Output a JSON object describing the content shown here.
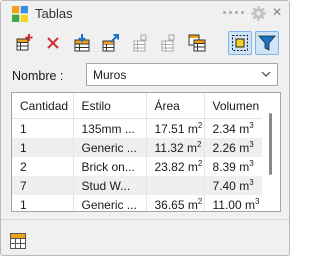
{
  "window": {
    "title": "Tablas"
  },
  "toolbar": {
    "buttons": [
      {
        "name": "add-schedule-button",
        "icon": "add-table-icon"
      },
      {
        "name": "delete-button",
        "icon": "delete-x-icon"
      },
      {
        "name": "import-button",
        "icon": "import-icon"
      },
      {
        "name": "export-button",
        "icon": "export-icon"
      },
      {
        "name": "settings-button",
        "icon": "table-settings-icon"
      },
      {
        "name": "settings-2-button",
        "icon": "table-settings-2-icon"
      },
      {
        "name": "copy-button",
        "icon": "copy-icon"
      },
      {
        "name": "select-button",
        "icon": "select-icon"
      },
      {
        "name": "filter-button",
        "icon": "filter-icon"
      }
    ]
  },
  "name_field": {
    "label": "Nombre :",
    "value": "Muros"
  },
  "table": {
    "headers": [
      "Cantidad",
      "Estilo",
      "Área",
      "Volumen"
    ],
    "rows": [
      {
        "cantidad": "1",
        "estilo": "135mm ...",
        "area": "17.51 m",
        "area_unit_exp": "2",
        "volumen": "2.34 m",
        "vol_unit_exp": "3"
      },
      {
        "cantidad": "1",
        "estilo": "Generic ...",
        "area": "11.32 m",
        "area_unit_exp": "2",
        "volumen": "2.26 m",
        "vol_unit_exp": "3"
      },
      {
        "cantidad": "2",
        "estilo": "Brick on...",
        "area": "23.82 m",
        "area_unit_exp": "2",
        "volumen": "8.39 m",
        "vol_unit_exp": "3"
      },
      {
        "cantidad": "7",
        "estilo": "Stud W...",
        "area": "",
        "area_unit_exp": "",
        "volumen": "7.40 m",
        "vol_unit_exp": "3"
      },
      {
        "cantidad": "1",
        "estilo": "Generic ...",
        "area": "36.65 m",
        "area_unit_exp": "2",
        "volumen": "11.00 m",
        "vol_unit_exp": "3"
      }
    ]
  },
  "colors": {
    "accent": "#1a73c8",
    "selected_bg": "#cfe5f7",
    "delete": "#d32f2f"
  }
}
